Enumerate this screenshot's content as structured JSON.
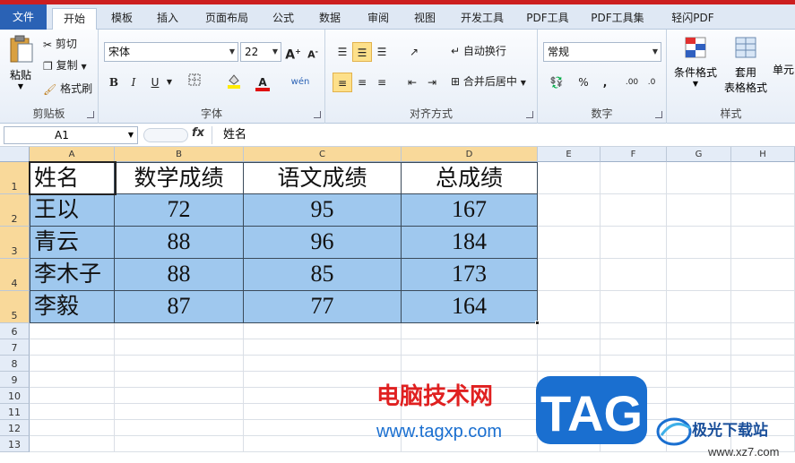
{
  "tabs": [
    "文件",
    "开始",
    "模板",
    "插入",
    "页面布局",
    "公式",
    "数据",
    "审阅",
    "视图",
    "开发工具",
    "PDF工具",
    "PDF工具集",
    "轻闪PDF"
  ],
  "clipboard": {
    "paste": "粘贴",
    "cut": "剪切",
    "copy": "复制",
    "format_painter": "格式刷",
    "label": "剪贴板"
  },
  "font": {
    "name": "宋体",
    "size": "22",
    "bold": "B",
    "italic": "I",
    "underline": "U",
    "label": "字体",
    "phonetic": "wén"
  },
  "align": {
    "wrap": "自动换行",
    "merge": "合并后居中",
    "label": "对齐方式"
  },
  "number": {
    "format": "常规",
    "percent": "%",
    "comma": ",",
    "label": "数字"
  },
  "styles": {
    "conditional": "条件格式",
    "table_format_1": "套用",
    "table_format_2": "表格格式",
    "cell_styles": "单元",
    "label": "样式"
  },
  "formula_bar": {
    "name_box": "A1",
    "fx": "fx",
    "content": "姓名"
  },
  "columns": [
    "A",
    "B",
    "C",
    "D",
    "E",
    "F",
    "G",
    "H"
  ],
  "rows": [
    "1",
    "2",
    "3",
    "4",
    "5",
    "6",
    "7",
    "8",
    "9",
    "10",
    "11",
    "12",
    "13"
  ],
  "table": {
    "headers": [
      "姓名",
      "数学成绩",
      "语文成绩",
      "总成绩"
    ],
    "rows": [
      [
        "王以",
        "72",
        "95",
        "167"
      ],
      [
        "青云",
        "88",
        "96",
        "184"
      ],
      [
        "李木子",
        "88",
        "85",
        "173"
      ],
      [
        "李毅",
        "87",
        "77",
        "164"
      ]
    ]
  },
  "watermark": {
    "site_cn": "电脑技术网",
    "tag": "TAG",
    "url": "www.tagxp.com",
    "brand": "极光下载站",
    "brand_url": "www.xz7.com"
  },
  "colors": {
    "accent": "#2a62b5",
    "selection": "#9fc8ee",
    "header_highlight": "#f9d99a",
    "watermark_red": "#e02020",
    "tag_blue": "#1a6fd0"
  }
}
